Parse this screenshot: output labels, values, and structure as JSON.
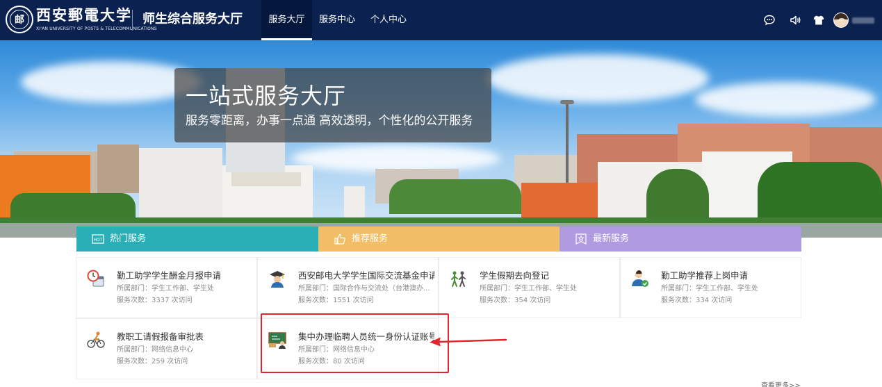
{
  "header": {
    "logo_emblem_glyph": "邮",
    "logo_cn": "西安郵電大学",
    "logo_en": "XI'AN UNIVERSITY OF POSTS & TELECOMMUNICATIONS",
    "site_title": "师生综合服务大厅",
    "tabs": [
      {
        "label": "服务大厅",
        "active": true
      },
      {
        "label": "服务中心",
        "active": false
      },
      {
        "label": "个人中心",
        "active": false
      }
    ],
    "icons": [
      "chat-icon",
      "speaker-icon",
      "tshirt-icon"
    ],
    "accent": "#0b2150"
  },
  "hero": {
    "title": "一站式服务大厅",
    "subtitle": "服务零距离，办事一点通 高效透明，个性化的公开服务"
  },
  "sections": [
    {
      "label": "热门服务",
      "icon": "hot-icon",
      "color": "#2bafb6"
    },
    {
      "label": "推荐服务",
      "icon": "thumbs-up-icon",
      "color": "#f1bd66"
    },
    {
      "label": "最新服务",
      "icon": "star-badge-icon",
      "color": "#b09be0"
    }
  ],
  "cards": [
    {
      "title": "勤工助学学生酬金月报申请",
      "dept": "所属部门：学生工作部、学生处",
      "visits": "服务次数：3337 次访问",
      "icon": "clock-calendar-icon"
    },
    {
      "title": "西安邮电大学学生国际交流基金申请",
      "dept": "所属部门：国际合作与交流处（台港澳办...",
      "visits": "服务次数：1551 次访问",
      "icon": "graduate-icon"
    },
    {
      "title": "学生假期去向登记",
      "dept": "所属部门：学生工作部、学生处",
      "visits": "服务次数：354 次访问",
      "icon": "walking-people-icon"
    },
    {
      "title": "勤工助学推荐上岗申请",
      "dept": "所属部门：学生工作部、学生处",
      "visits": "服务次数：334 次访问",
      "icon": "user-check-icon"
    },
    {
      "title": "教职工请假报备审批表",
      "dept": "所属部门：网络信息中心",
      "visits": "服务次数：259 次访问",
      "icon": "cyclist-icon"
    },
    {
      "title": "集中办理临聘人员统一身份认证账号",
      "dept": "所属部门：网络信息中心",
      "visits": "服务次数：80 次访问",
      "icon": "classroom-board-icon"
    }
  ],
  "more_label": "查看更多>>"
}
